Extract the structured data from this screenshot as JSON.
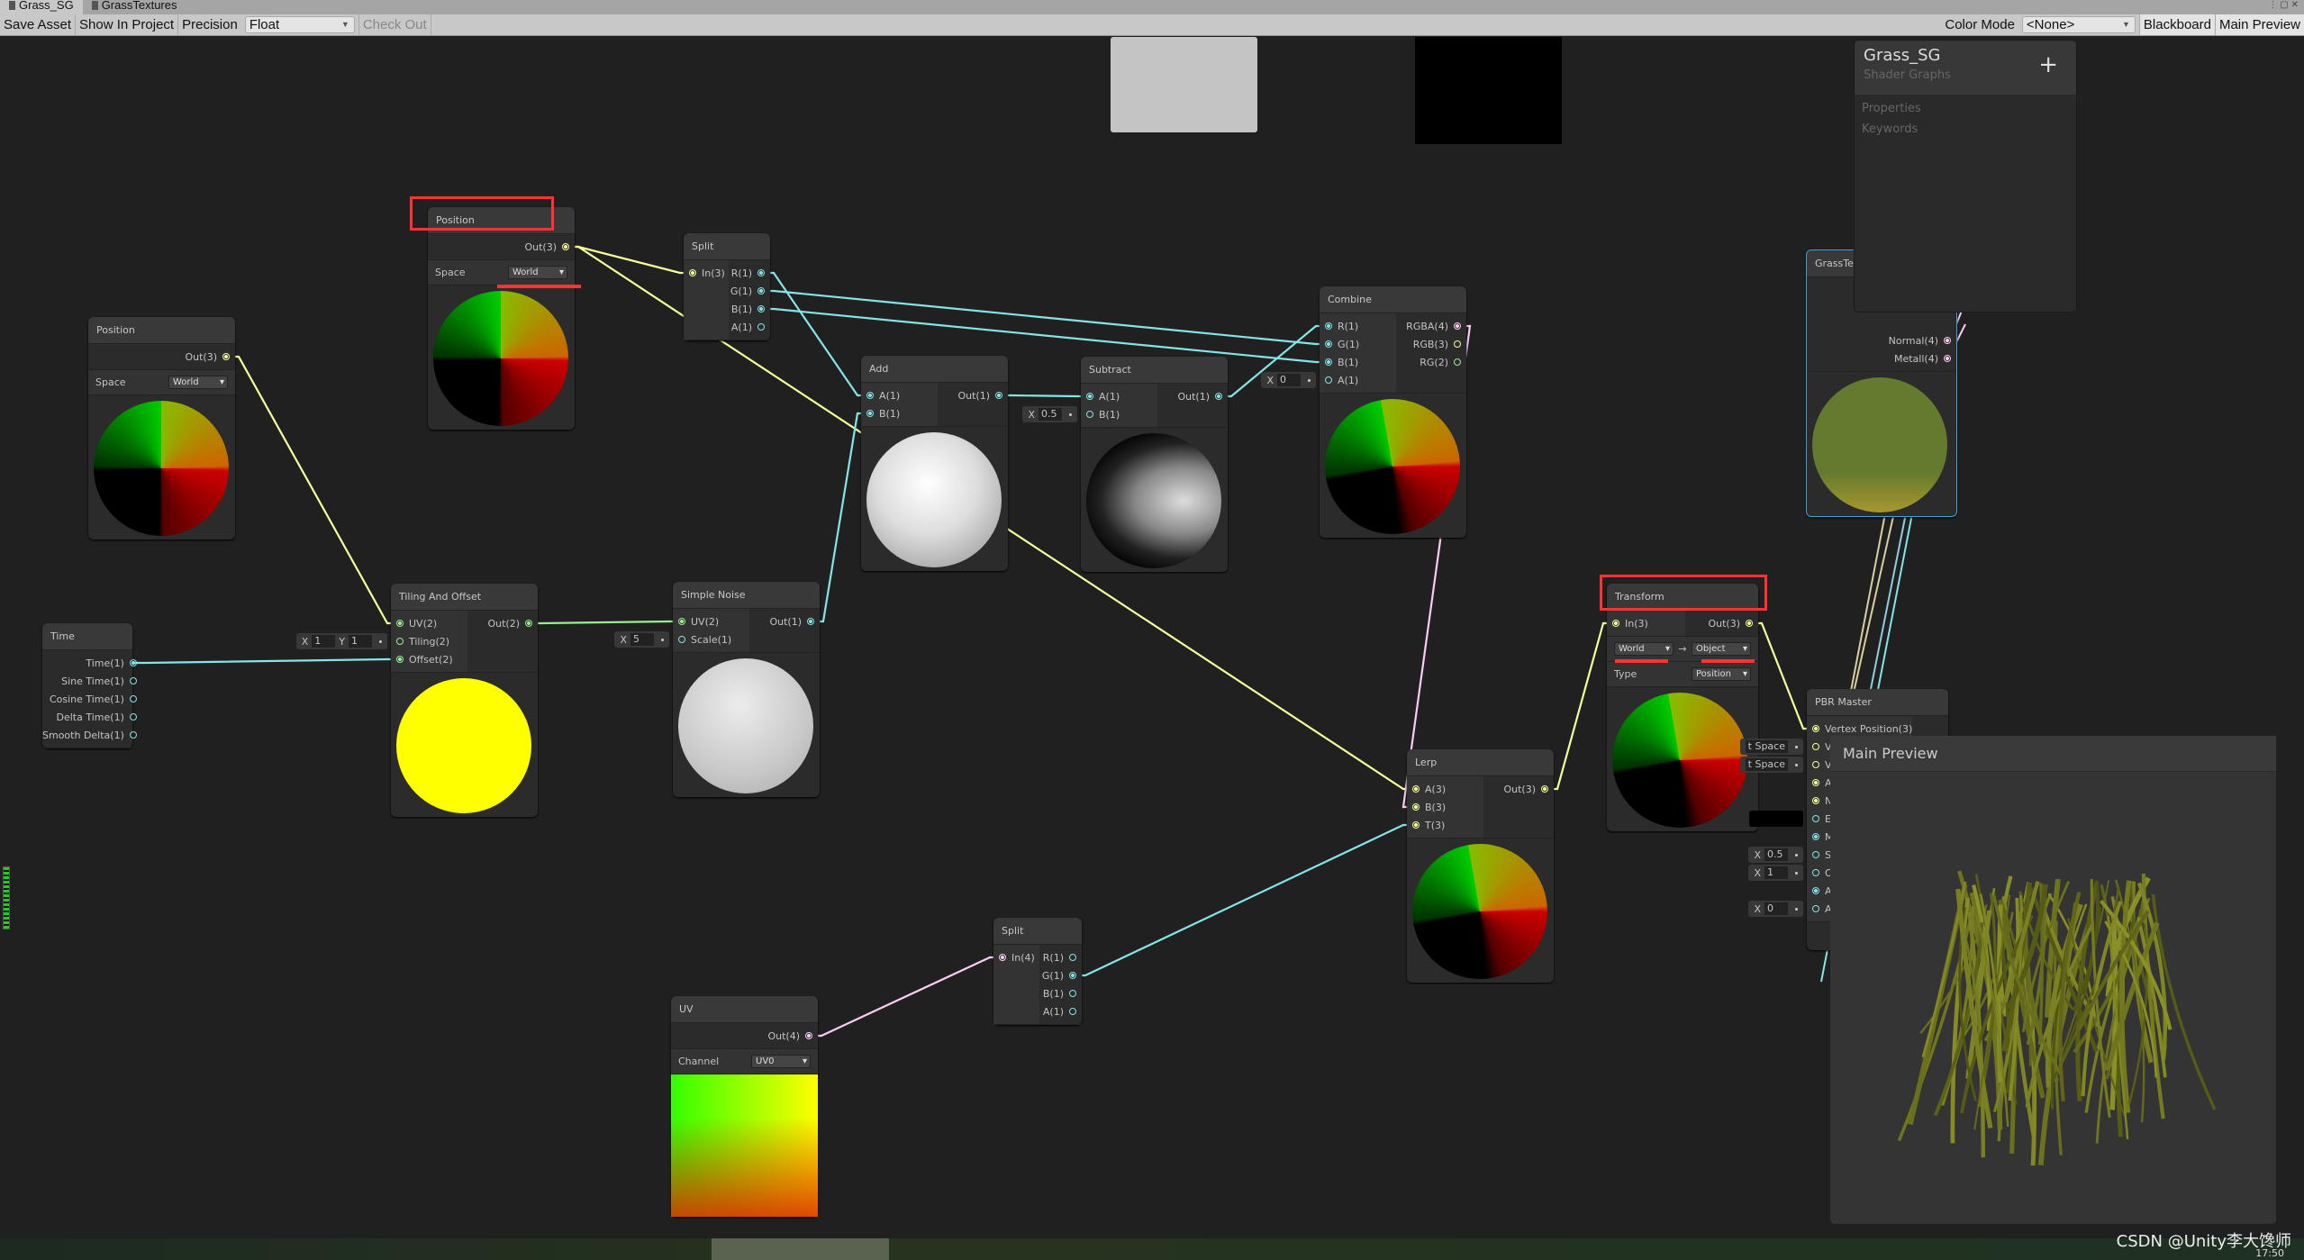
{
  "tabs": [
    {
      "label": "Grass_SG",
      "active": true
    },
    {
      "label": "GrassTextures",
      "active": false
    }
  ],
  "toolbar": {
    "save_asset": "Save Asset",
    "show_in_project": "Show In Project",
    "precision_label": "Precision",
    "precision_value": "Float",
    "check_out": "Check Out",
    "color_mode_label": "Color Mode",
    "color_mode_value": "<None>",
    "blackboard": "Blackboard",
    "main_preview": "Main Preview"
  },
  "blackboard": {
    "title": "Grass_SG",
    "subtitle": "Shader Graphs",
    "add": "+",
    "sections": [
      "Properties",
      "Keywords"
    ]
  },
  "port_colors": {
    "1": "#84e4e7",
    "2": "#9aef92",
    "3": "#f6ff9a",
    "4": "#fbcbf4"
  },
  "highlight_color": "#ff3333",
  "nodes": {
    "position_a": {
      "title": "Position",
      "inputs": [],
      "outputs": [
        "Out(3)"
      ],
      "fields": [
        {
          "label": "Space",
          "value": "World"
        }
      ],
      "highlighted": true
    },
    "position_b": {
      "title": "Position",
      "inputs": [],
      "outputs": [
        "Out(3)"
      ],
      "fields": [
        {
          "label": "Space",
          "value": "World"
        }
      ]
    },
    "split_a": {
      "title": "Split",
      "inputs": [
        "In(3)"
      ],
      "outputs": [
        "R(1)",
        "G(1)",
        "B(1)",
        "A(1)"
      ]
    },
    "time": {
      "title": "Time",
      "inputs": [],
      "outputs": [
        "Time(1)",
        "Sine Time(1)",
        "Cosine Time(1)",
        "Delta Time(1)",
        "Smooth Delta(1)"
      ]
    },
    "tiling": {
      "title": "Tiling And Offset",
      "inputs": [
        "UV(2)",
        "Tiling(2)",
        "Offset(2)"
      ],
      "outputs": [
        "Out(2)"
      ],
      "defaults": {
        "1": [
          [
            "X",
            "1"
          ],
          [
            "Y",
            "1"
          ]
        ]
      }
    },
    "noise": {
      "title": "Simple Noise",
      "inputs": [
        "UV(2)",
        "Scale(1)"
      ],
      "outputs": [
        "Out(1)"
      ],
      "defaults": {
        "1": [
          [
            "X",
            "5"
          ]
        ]
      }
    },
    "add": {
      "title": "Add",
      "inputs": [
        "A(1)",
        "B(1)"
      ],
      "outputs": [
        "Out(1)"
      ]
    },
    "subtract": {
      "title": "Subtract",
      "inputs": [
        "A(1)",
        "B(1)"
      ],
      "outputs": [
        "Out(1)"
      ],
      "defaults": {
        "1": [
          [
            "X",
            "0.5"
          ]
        ]
      }
    },
    "combine": {
      "title": "Combine",
      "inputs": [
        "R(1)",
        "G(1)",
        "B(1)",
        "A(1)"
      ],
      "outputs": [
        "RGBA(4)",
        "RGB(3)",
        "RG(2)"
      ],
      "defaults": {
        "3": [
          [
            "X",
            "0"
          ]
        ]
      }
    },
    "lerp": {
      "title": "Lerp",
      "inputs": [
        "A(3)",
        "B(3)",
        "T(3)"
      ],
      "outputs": [
        "Out(3)"
      ]
    },
    "split_b": {
      "title": "Split",
      "inputs": [
        "In(4)"
      ],
      "outputs": [
        "R(1)",
        "G(1)",
        "B(1)",
        "A(1)"
      ]
    },
    "uv": {
      "title": "UV",
      "inputs": [],
      "outputs": [
        "Out(4)"
      ],
      "fields": [
        {
          "label": "Channel",
          "value": "UV0"
        }
      ]
    },
    "transform": {
      "title": "Transform",
      "inputs": [
        "In(3)"
      ],
      "outputs": [
        "Out(3)"
      ],
      "from": "World",
      "to": "Object",
      "arrow": "→",
      "fields": [
        {
          "label": "Type",
          "value": "Position"
        }
      ],
      "highlighted": true
    },
    "grasstex": {
      "title": "GrassTex",
      "inputs": [],
      "outputs": [
        "Normal(4)",
        "Metall(4)"
      ]
    },
    "pbr": {
      "title": "PBR Master",
      "inputs": [
        "Vertex Position(3)",
        "V",
        "V",
        "A",
        "N",
        "E",
        "M",
        "S",
        "O",
        "A",
        "A"
      ],
      "outputs": [],
      "defaults": {
        "1": [
          [
            "",
            "t Space"
          ]
        ],
        "2": [
          [
            "",
            "t Space"
          ]
        ],
        "7": [
          [
            "X",
            "0.5"
          ]
        ],
        "8": [
          [
            "X",
            "1"
          ]
        ],
        "10": [
          [
            "X",
            "0"
          ]
        ]
      }
    }
  },
  "main_preview": {
    "title": "Main Preview"
  },
  "watermark": "CSDN @Unity李大馋师",
  "taskbar": {
    "time": "17:50"
  }
}
